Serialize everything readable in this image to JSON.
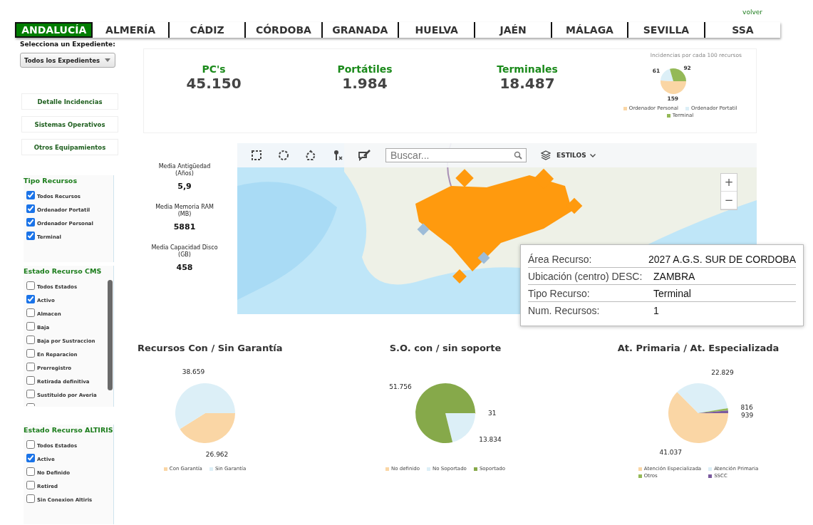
{
  "top_link": "volver",
  "tabs": [
    {
      "label": "ANDALUCÍA",
      "selected": true
    },
    {
      "label": "ALMERÍA",
      "selected": false
    },
    {
      "label": "CÁDIZ",
      "selected": false
    },
    {
      "label": "CÓRDOBA",
      "selected": false
    },
    {
      "label": "GRANADA",
      "selected": false
    },
    {
      "label": "HUELVA",
      "selected": false
    },
    {
      "label": "JAÉN",
      "selected": false
    },
    {
      "label": "MÁLAGA",
      "selected": false
    },
    {
      "label": "SEVILLA",
      "selected": false
    },
    {
      "label": "SSA",
      "selected": false
    }
  ],
  "sidebar": {
    "expediente_label": "Selecciona un Expediente:",
    "expediente_select": "Todos los Expedientes",
    "buttons": [
      "Detalle Incidencias",
      "Sistemas Operativos",
      "Otros Equipamientos"
    ],
    "filters": [
      {
        "title": "Tipo Recursos",
        "scrollable": false,
        "items": [
          {
            "label": "Todos Recursos",
            "checked": true
          },
          {
            "label": "Ordenador Portatil",
            "checked": true
          },
          {
            "label": "Ordenador Personal",
            "checked": true
          },
          {
            "label": "Terminal",
            "checked": true
          }
        ]
      },
      {
        "title": "Estado Recurso CMS",
        "scrollable": true,
        "items": [
          {
            "label": "Todos Estados",
            "checked": false
          },
          {
            "label": "Activo",
            "checked": true
          },
          {
            "label": "Almacen",
            "checked": false
          },
          {
            "label": "Baja",
            "checked": false
          },
          {
            "label": "Baja por Sustraccion",
            "checked": false
          },
          {
            "label": "En Reparacion",
            "checked": false
          },
          {
            "label": "Prerregistro",
            "checked": false
          },
          {
            "label": "Retirada definitiva",
            "checked": false
          },
          {
            "label": "Sustituido por Averia",
            "checked": false
          },
          {
            "checked": false
          }
        ]
      },
      {
        "title": "Estado Recurso ALTIRIS",
        "scrollable": false,
        "items": [
          {
            "label": "Todos Estados",
            "checked": false
          },
          {
            "label": "Active",
            "checked": true
          },
          {
            "label": "No Definido",
            "checked": false
          },
          {
            "label": "Retired",
            "checked": false
          },
          {
            "label": "Sin Conexion Altiris",
            "checked": false
          }
        ]
      }
    ]
  },
  "kpis": [
    {
      "label": "PC's",
      "value": "45.150"
    },
    {
      "label": "Portátiles",
      "value": "1.984"
    },
    {
      "label": "Terminales",
      "value": "18.487"
    }
  ],
  "incidencias": {
    "chart_data": {
      "type": "pie",
      "title": "Incidencias por cada 100 recursos",
      "categories": [
        "Ordenador Personal",
        "Ordenador Portatil",
        "Terminal"
      ],
      "values": [
        159,
        61,
        92
      ],
      "data_labels": true,
      "value_labels": [
        "159",
        "61",
        "92"
      ],
      "legend": "bottom"
    },
    "slices": [
      {
        "color": "#fad6a5"
      },
      {
        "color": "#dceff7"
      },
      {
        "color": "#94b957"
      }
    ]
  },
  "stats": [
    {
      "label": "Media Antigüedad",
      "unit": "(Años)",
      "value": "5,9"
    },
    {
      "label": "Media Memoria RAM",
      "unit": "(MB)",
      "value": "5881"
    },
    {
      "label": "Media Capacidad Disco",
      "unit": "(GB)",
      "value": "458"
    }
  ],
  "map": {
    "search": {
      "placeholder": "Buscar..."
    },
    "styles_label": "ESTILOS",
    "zoom": [
      "+",
      "−"
    ],
    "popup": [
      {
        "label": "Área Recurso:",
        "value": "2027 A.G.S. SUR DE CORDOBA"
      },
      {
        "label": "Ubicación (centro) DESC:",
        "value": "ZAMBRA"
      },
      {
        "label": "Tipo Recurso:",
        "value": "Terminal"
      },
      {
        "label": "Num. Recursos:",
        "value": "1"
      }
    ]
  },
  "charts": [
    {
      "chart_data": {
        "type": "pie",
        "title": "Recursos Con / Sin Garantía",
        "categories": [
          "Con Garantía",
          "Sin Garantía"
        ],
        "values": [
          26962,
          38659
        ],
        "data_labels": true,
        "value_labels": [
          "26.962",
          "38.659"
        ],
        "legend": "bottom"
      },
      "slices": [
        {
          "color": "#fad6a5"
        },
        {
          "color": "#dceff7"
        }
      ]
    },
    {
      "chart_data": {
        "type": "pie",
        "title": "S.O. con / sin soporte",
        "categories": [
          "No definido",
          "No Soportado",
          "Soportado"
        ],
        "values": [
          31,
          13834,
          51756
        ],
        "data_labels": true,
        "value_labels": [
          "31",
          "13.834",
          "51.756"
        ],
        "legend": "bottom"
      },
      "slices": [
        {
          "color": "#fad6a5"
        },
        {
          "color": "#dceff7"
        },
        {
          "color": "#86a94a"
        }
      ]
    },
    {
      "chart_data": {
        "type": "pie",
        "title": "At. Primaria / At. Especializada",
        "categories": [
          "Atención Especializada",
          "Atención Primaria",
          "Otros",
          "SSCC"
        ],
        "values": [
          41037,
          22829,
          816,
          939
        ],
        "data_labels": true,
        "value_labels": [
          "41.037",
          "22.829",
          "816",
          "939"
        ],
        "legend": "bottom"
      },
      "slices": [
        {
          "color": "#fad6a5"
        },
        {
          "color": "#dceff7"
        },
        {
          "color": "#94b957"
        },
        {
          "color": "#7b5a9e"
        }
      ]
    }
  ]
}
